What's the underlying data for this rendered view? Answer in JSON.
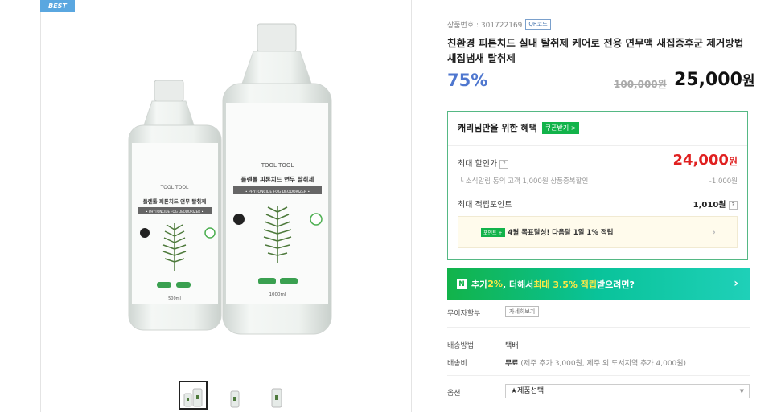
{
  "badge": "BEST",
  "product": {
    "code_label": "상품번호 : 301722169",
    "qr_label": "QR코드",
    "title": "친환경 피톤치드 실내 탈취제 케어로 전용 연무액 새집증후군 제거방법 새집냄새 탈취제",
    "discount": "75%",
    "original_price": "100,000원",
    "price": "25,000",
    "price_unit": "원"
  },
  "images": {
    "small_bottle": {
      "brand": "TOOL TOOL",
      "name": "플렌톨 피톤치드 연무 탈취제",
      "sub": "• PHYTONCIDE FOG DEODORIZER •",
      "volume": "500ml"
    },
    "large_bottle": {
      "brand": "TOOL TOOL",
      "name": "플렌톨 피톤치드 연무 탈취제",
      "sub": "• PHYTONCIDE FOG DEODORIZER •",
      "volume": "1000ml"
    }
  },
  "benefit": {
    "heading": "캐리님만을 위한 혜택",
    "coupon_button": "쿠폰받기 >",
    "max_discount_label": "최대 할인가",
    "max_discount_value": "24,000",
    "max_discount_unit": "원",
    "sub_label": "└ 소식알림 동의 고객 1,000원 상품중복할인",
    "sub_value": "-1,000원",
    "points_label": "최대 적립포인트",
    "points_value": "1,010원",
    "goal_tag": "포인트 +",
    "goal_text": "4월 목표달성! 다음달 1일 1% 적립",
    "goal_arrow": "›"
  },
  "naver_banner": {
    "logo": "N",
    "text_a": "추가",
    "text_b": "2%",
    "text_c": ", 더해서 ",
    "text_d": "최대 3.5% 적립",
    "text_e": " 받으려면?",
    "arrow": "›"
  },
  "info": {
    "installment_label": "무이자할부",
    "installment_button": "자세히보기",
    "shipping_method_label": "배송방법",
    "shipping_method_value": "택배",
    "shipping_fee_label": "배송비",
    "shipping_fee_value": "무료",
    "shipping_fee_note": " (제주 추가 3,000원, 제주 외 도서지역 추가 4,000원)",
    "option_label": "옵션",
    "option_value": "★제품선택"
  },
  "colors": {
    "accent_green": "#12b34a",
    "discount_blue": "#4f77cf",
    "price_red": "#e02020",
    "badge_blue": "#5aa7e0"
  }
}
